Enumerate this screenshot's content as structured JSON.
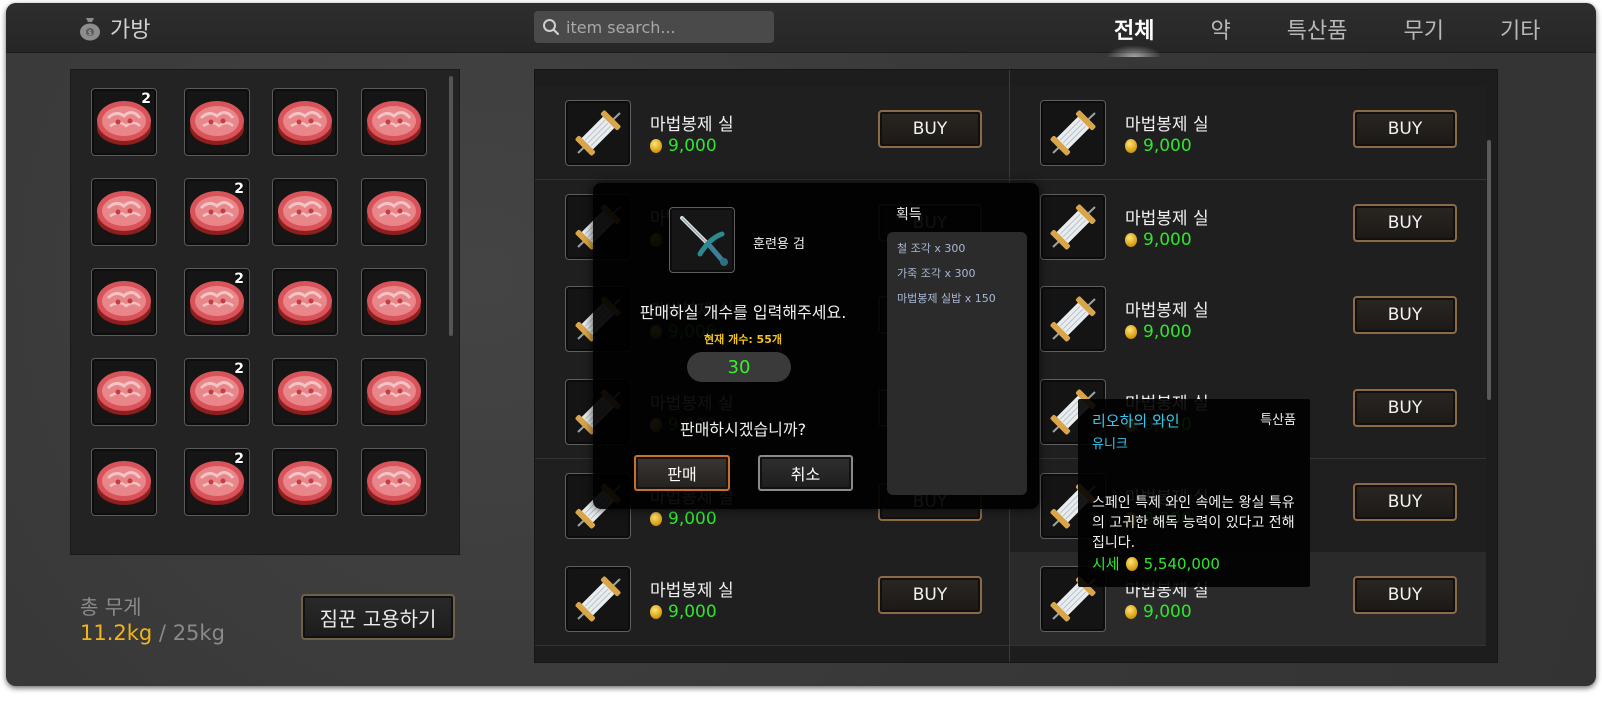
{
  "header": {
    "title": "가방",
    "search_placeholder": "item search...",
    "tabs": [
      {
        "label": "전체",
        "active": true
      },
      {
        "label": "약",
        "active": false
      },
      {
        "label": "특산품",
        "active": false
      },
      {
        "label": "무기",
        "active": false
      },
      {
        "label": "기타",
        "active": false
      }
    ]
  },
  "inventory": {
    "item_icon": "meat-icon",
    "slots": [
      {
        "qty": "2"
      },
      {
        "qty": ""
      },
      {
        "qty": ""
      },
      {
        "qty": ""
      },
      {
        "qty": ""
      },
      {
        "qty": "2"
      },
      {
        "qty": ""
      },
      {
        "qty": ""
      },
      {
        "qty": ""
      },
      {
        "qty": "2"
      },
      {
        "qty": ""
      },
      {
        "qty": ""
      },
      {
        "qty": ""
      },
      {
        "qty": "2"
      },
      {
        "qty": ""
      },
      {
        "qty": ""
      },
      {
        "qty": ""
      },
      {
        "qty": "2"
      },
      {
        "qty": ""
      },
      {
        "qty": ""
      }
    ]
  },
  "weight": {
    "label": "총 무게",
    "current": "11.2kg",
    "separator": " / ",
    "max": "25kg"
  },
  "hire_button": "짐꾼 고용하기",
  "shop": {
    "item_icon": "thread-spool-icon",
    "buy_label": "BUY",
    "left_column": [
      {
        "name": "마법봉제 실",
        "price": "9,000"
      },
      {
        "name": "마법봉제 실",
        "price": "9,000"
      },
      {
        "name": "마법봉제 실",
        "price": "9,000"
      },
      {
        "name": "마법봉제 실",
        "price": "9,000"
      },
      {
        "name": "마법봉제 실",
        "price": "9,000"
      },
      {
        "name": "마법봉제 실",
        "price": "9,000"
      }
    ],
    "right_column": [
      {
        "name": "마법봉제 실",
        "price": "9,000"
      },
      {
        "name": "마법봉제 실",
        "price": "9,000"
      },
      {
        "name": "마법봉제 실",
        "price": "9,000"
      },
      {
        "name": "마법봉제 실",
        "price": "9,000"
      },
      {
        "name": "마법봉제 실",
        "price": "9,000"
      },
      {
        "name": "마법봉제 실",
        "price": "9,000"
      }
    ]
  },
  "sell_dialog": {
    "item_icon": "sword-icon",
    "item_name": "훈련용 검",
    "prompt": "판매하실 개수를 입력해주세요.",
    "current_count": "현재 개수: 55개",
    "input_value": "30",
    "confirm_question": "판매하시겠습니까?",
    "sell_button": "판매",
    "cancel_button": "취소",
    "acquire_title": "획득",
    "acquire_items": [
      "철 조각 x 300",
      "가죽 조각 x 300",
      "마법봉제 실밥 x 150"
    ]
  },
  "tooltip": {
    "name": "리오하의 와인",
    "category": "특산품",
    "rarity": "유니크",
    "description": "스페인 특제 와인 속에는 왕실 특유의 고귀한 해독 능력이 있다고 전해집니다.",
    "price_label": "시세",
    "price": "5,540,000"
  },
  "colors": {
    "price_green": "#2ee62e",
    "weight_gold": "#f2b418",
    "rarity_cyan": "#35c8ee",
    "sell_border": "#c5702f"
  }
}
